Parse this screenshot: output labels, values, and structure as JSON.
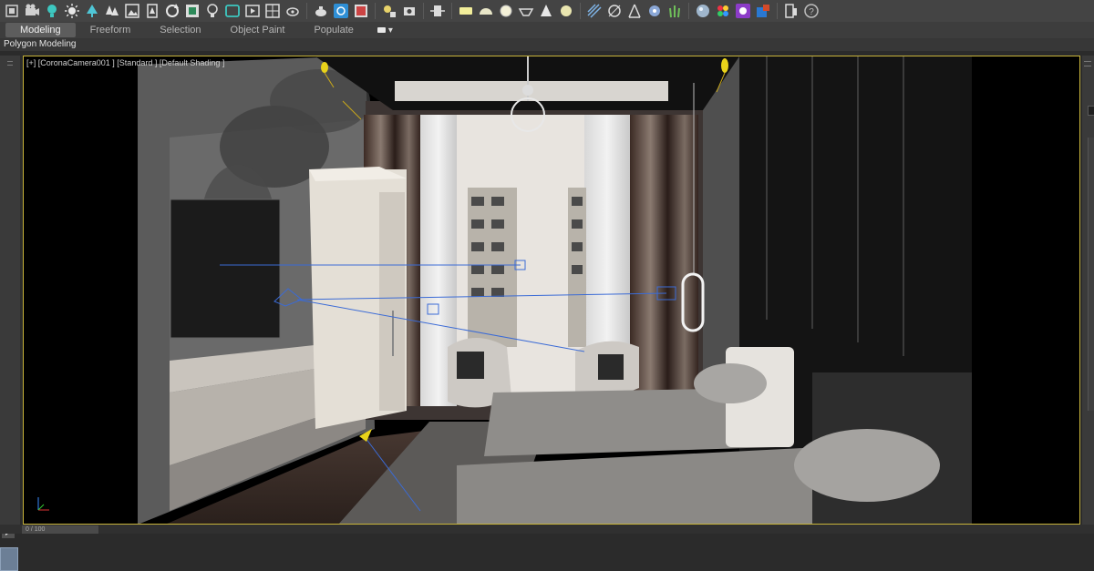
{
  "toolbar": {
    "icons": [
      "create-geometry-icon",
      "camera-icon",
      "light-icon",
      "sun-icon",
      "tree-icon",
      "tree2-icon",
      "photo-icon",
      "bin-icon",
      "refresh-icon",
      "save-icon",
      "bulb-icon",
      "frame-icon",
      "render-frame-icon",
      "safe-frame-icon",
      "teapot-icon",
      "teapot2-icon",
      "render-setup-icon",
      "render-window-icon",
      "light-lister-icon",
      "camera-correction-icon",
      "proxy-icon",
      "plane-icon",
      "dome-icon",
      "disk-icon",
      "bowl-icon",
      "cone-icon",
      "sphere-light-icon",
      "pattern-icon",
      "distance-icon",
      "tripod-icon",
      "scatter-icon",
      "grass-icon",
      "material-ball-icon",
      "color-picker-icon",
      "slate-material-icon",
      "converter-icon",
      "window-icon",
      "help-icon"
    ],
    "help_label": "?"
  },
  "ribbon": {
    "tabs": [
      "Modeling",
      "Freeform",
      "Selection",
      "Object Paint",
      "Populate"
    ],
    "active_tab": "Modeling"
  },
  "subbar": {
    "label": "Polygon Modeling"
  },
  "viewport": {
    "label": "[+] [CoronaCamera001 ] [Standard ] [Default Shading ]",
    "border_color": "#c8b43a"
  },
  "status": {
    "field_text": "0 / 100"
  }
}
